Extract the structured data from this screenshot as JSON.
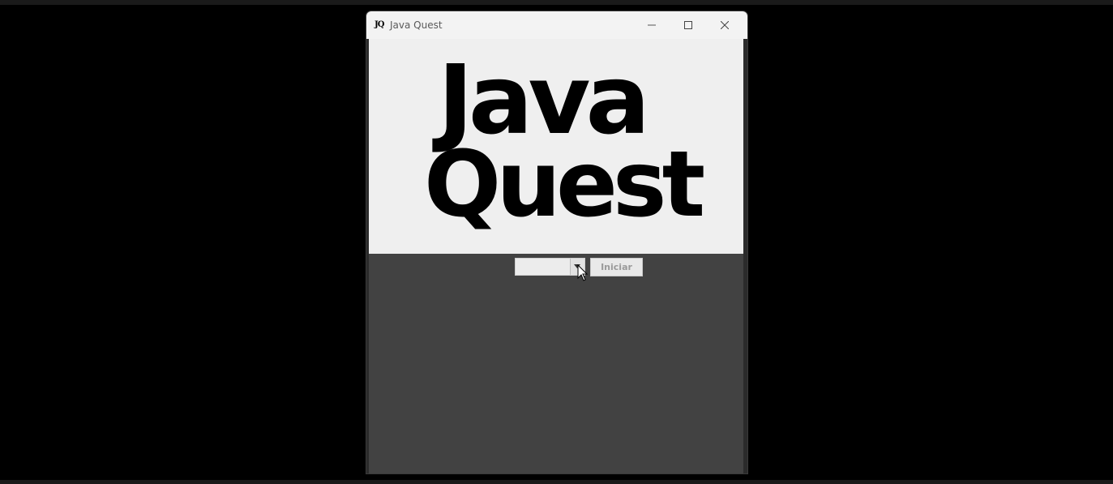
{
  "window": {
    "title": "Java Quest",
    "icon_label": "JQ"
  },
  "logo": {
    "line1": "Java",
    "line2": "Quest"
  },
  "controls": {
    "select_label": "",
    "combo_value": "",
    "start_label": "Iniciar"
  },
  "colors": {
    "logo_panel_bg": "#efefef",
    "content_bg": "#424242",
    "titlebar_bg": "#f3f3f3"
  },
  "icons": {
    "app": "jq-logo-icon",
    "minimize": "minimize-icon",
    "maximize": "maximize-icon",
    "close": "close-icon",
    "dropdown": "chevron-down-icon",
    "cursor": "mouse-cursor-icon"
  }
}
